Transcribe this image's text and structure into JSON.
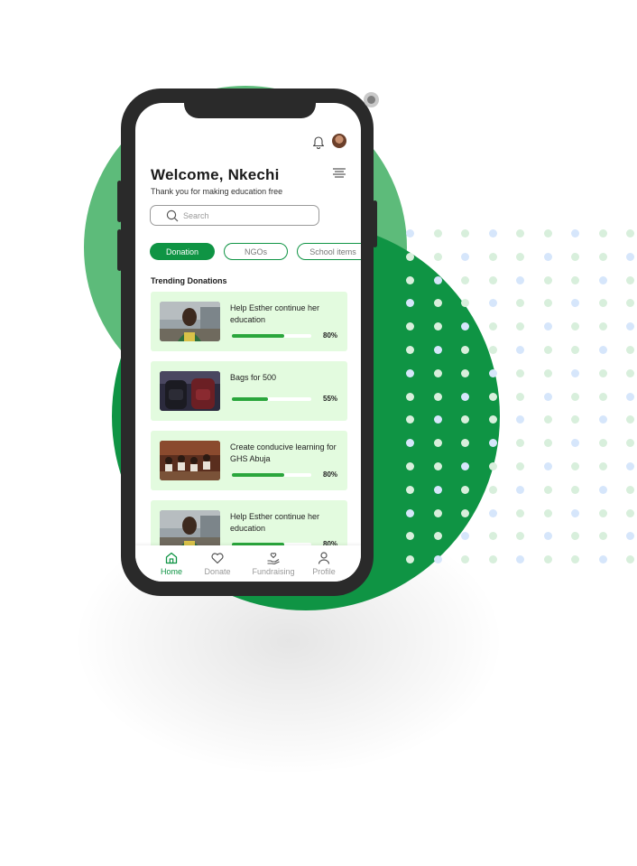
{
  "header": {
    "welcome": "Welcome, Nkechi",
    "subtitle": "Thank you for making education free"
  },
  "search": {
    "placeholder": "Search"
  },
  "filters": [
    {
      "label": "Donation",
      "active": true
    },
    {
      "label": "NGOs",
      "active": false
    },
    {
      "label": "School items",
      "active": false
    }
  ],
  "trending": {
    "title": "Trending Donations",
    "items": [
      {
        "title": "Help Esther continue her education",
        "progress_label": "80%",
        "progress": 0.8,
        "image": "student-girl-photo"
      },
      {
        "title": "Bags for 500",
        "progress_label": "55%",
        "progress": 0.55,
        "image": "school-bags-photo"
      },
      {
        "title": "Create conducive learning for GHS Abuja",
        "progress_label": "80%",
        "progress": 0.8,
        "image": "classroom-photo"
      },
      {
        "title": "Help Esther continue her education",
        "progress_label": "80%",
        "progress": 0.8,
        "image": "student-girl-photo"
      }
    ]
  },
  "nav": [
    {
      "label": "Home",
      "icon": "home-icon",
      "active": true
    },
    {
      "label": "Donate",
      "icon": "heart-icon",
      "active": false
    },
    {
      "label": "Fundraising",
      "icon": "hand-heart-icon",
      "active": false
    },
    {
      "label": "Profile",
      "icon": "user-icon",
      "active": false
    }
  ],
  "colors": {
    "brand_green": "#0f9444",
    "light_green_circle": "#5dbb7a",
    "card_background": "#e3fbdf",
    "progress_fill": "#2aa63c"
  }
}
